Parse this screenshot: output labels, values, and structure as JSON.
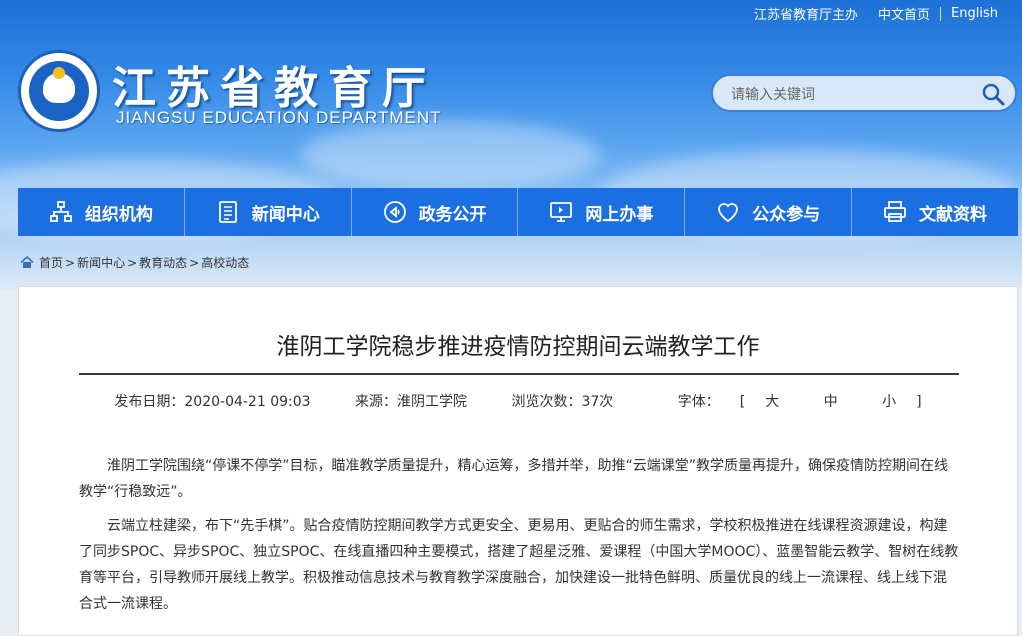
{
  "top_links": {
    "sponsor": "江苏省教育厅主办",
    "chinese": "中文首页",
    "english": "English"
  },
  "site": {
    "title": "江苏省教育厅",
    "subtitle": "JIANGSU EDUCATION DEPARTMENT"
  },
  "search": {
    "placeholder": "请输入关键词"
  },
  "nav": [
    {
      "label": "组织机构",
      "icon": "org-chart-icon"
    },
    {
      "label": "新闻中心",
      "icon": "document-icon"
    },
    {
      "label": "政务公开",
      "icon": "megaphone-icon"
    },
    {
      "label": "网上办事",
      "icon": "monitor-icon"
    },
    {
      "label": "公众参与",
      "icon": "heart-icon"
    },
    {
      "label": "文献资料",
      "icon": "printer-icon"
    }
  ],
  "breadcrumb": [
    "首页",
    "新闻中心",
    "教育动态",
    "高校动态"
  ],
  "article": {
    "title": "淮阴工学院稳步推进疫情防控期间云端教学工作",
    "meta": {
      "date": "发布日期：2020-04-21 09:03",
      "source": "来源：淮阴工学院",
      "views": "浏览次数：37次",
      "font_label": "字体：",
      "font_sizes": [
        "大",
        "中",
        "小"
      ]
    },
    "paragraphs": [
      "淮阴工学院围绕“停课不停学”目标，瞄准教学质量提升，精心运筹，多措并举，助推“云端课堂”教学质量再提升，确保疫情防控期间在线教学“行稳致远”。",
      "云端立柱建梁，布下“先手棋”。贴合疫情防控期间教学方式更安全、更易用、更贴合的师生需求，学校积极推进在线课程资源建设，构建了同步SPOC、异步SPOC、独立SPOC、在线直播四种主要模式，搭建了超星泛雅、爱课程（中国大学MOOC）、蓝墨智能云教学、智树在线教育等平台，引导教师开展线上教学。积极推动信息技术与教育教学深度融合，加快建设一批特色鲜明、质量优良的线上一流课程、线上线下混合式一流课程。"
    ]
  }
}
